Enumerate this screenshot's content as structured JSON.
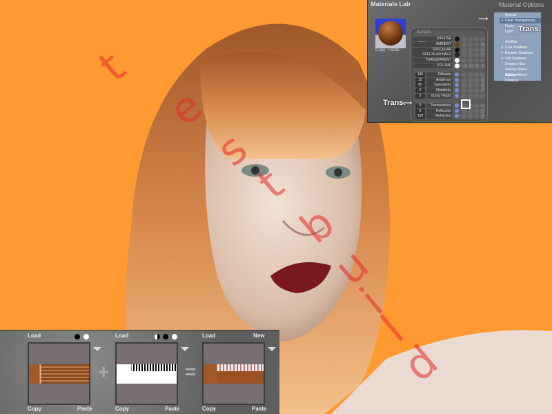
{
  "watermark": "test build",
  "materials_lab": {
    "title": "Materials Lab",
    "options_title": "Material Options",
    "preview": {
      "copy": "Copy",
      "paste": "Paste"
    },
    "surface_label": "Surface",
    "color_rows": [
      {
        "label": "Diffuse",
        "color": "#111111"
      },
      {
        "label": "Ambient",
        "color": "#6a4a10"
      },
      {
        "label": "Specular",
        "color": "#111111"
      },
      {
        "label": "Specular Halo",
        "color": "#222222"
      },
      {
        "label": "Transparent",
        "color": "#ffffff"
      },
      {
        "label": "Volume",
        "color": "#ffffff"
      }
    ],
    "columns": [
      "A",
      "B",
      "C",
      "D"
    ],
    "value_rows": [
      {
        "label": "Diffusion",
        "value": "100"
      },
      {
        "label": "Ambience",
        "value": "15"
      },
      {
        "label": "Specularity",
        "value": "65"
      },
      {
        "label": "Metallicity",
        "value": "0"
      },
      {
        "label": "Bump Height",
        "value": "0"
      }
    ],
    "optics_rows": [
      {
        "label": "Transparency",
        "value": "0"
      },
      {
        "label": "Reflection",
        "value": "0"
      },
      {
        "label": "Refraction",
        "value": "100"
      }
    ],
    "side_labels": {
      "color": "COLOR",
      "value": "VALUE",
      "optics": "OPTICS"
    },
    "menu": {
      "items": [
        {
          "label": "Normal",
          "checked": false
        },
        {
          "label": "Clear Transparency",
          "checked": true,
          "selected": true
        },
        {
          "label": "Fuzzy",
          "checked": false
        },
        {
          "label": "Light",
          "checked": false
        }
      ],
      "options": [
        {
          "label": "Additive",
          "checked": false
        },
        {
          "label": "Cast Shadows",
          "checked": true
        },
        {
          "label": "Receive Shadows",
          "checked": true
        },
        {
          "label": "Self Shadows",
          "checked": true
        },
        {
          "label": "Distance Blur",
          "checked": false
        },
        {
          "label": "Volume Blend - Additive",
          "checked": false
        },
        {
          "label": "Volume Blend - Distance",
          "checked": false
        }
      ]
    },
    "annotation_top": "Trans.",
    "annotation_left": "Trans."
  },
  "texture_panel": {
    "boxes": [
      {
        "load": "Load",
        "copy": "Copy",
        "paste": "Paste"
      },
      {
        "load": "Load",
        "copy": "Copy",
        "paste": "Paste"
      },
      {
        "load": "Load",
        "copy": "Copy",
        "paste": "Paste",
        "new": "New"
      }
    ],
    "plus": "+",
    "equals": "="
  }
}
